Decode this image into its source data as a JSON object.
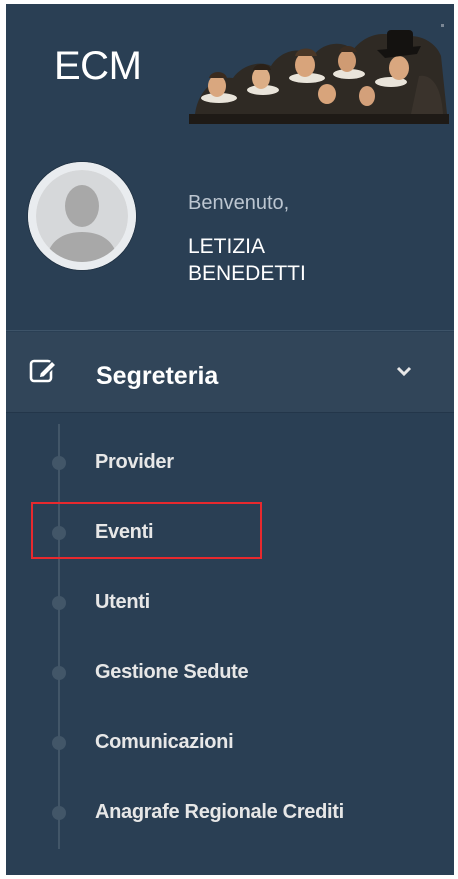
{
  "brand": {
    "title": "ECM"
  },
  "profile": {
    "welcome": "Benvenuto,",
    "name_line1": "LETIZIA",
    "name_line2": "BENEDETTI"
  },
  "menu": {
    "section_label": "Segreteria",
    "items": [
      {
        "label": "Provider"
      },
      {
        "label": "Eventi"
      },
      {
        "label": "Utenti"
      },
      {
        "label": "Gestione Sedute"
      },
      {
        "label": "Comunicazioni"
      },
      {
        "label": "Anagrafe Regionale Crediti"
      }
    ]
  },
  "colors": {
    "sidebar_bg": "#2a3f54",
    "section_bg": "#314559",
    "accent_green": "#1abb9c",
    "highlight_red": "#e8292e"
  },
  "icons": {
    "section": "edit-icon",
    "expand": "chevron-down-icon",
    "avatar": "user-silhouette-icon",
    "logo": "painting-logo"
  }
}
